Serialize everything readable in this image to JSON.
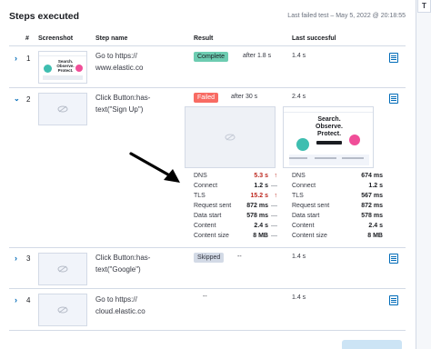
{
  "panel": {
    "title": "Steps executed",
    "last_failed": "Last failed test – May 5, 2022 @ 20:18:55",
    "edge_tab_label": "T"
  },
  "columns": [
    "#",
    "Screenshot",
    "Step name",
    "Result",
    "Last succesful"
  ],
  "steps": [
    {
      "num": "1",
      "name": "Go to https:// www.elastic.co",
      "status": "Complete",
      "status_tone": "success",
      "duration": "after 1.8 s",
      "last_successful": "1.4 s",
      "expanded": false
    },
    {
      "num": "2",
      "name": "Click Button:has-text(\"Sign Up\")",
      "status": "Failed",
      "status_tone": "danger",
      "duration": "after 30 s",
      "last_successful": "2.4 s",
      "expanded": true
    },
    {
      "num": "3",
      "name": "Click Button:has-text(\"Google\")",
      "status": "Skipped",
      "status_tone": "neutral",
      "duration": "--",
      "last_successful": "1.4 s",
      "expanded": false
    },
    {
      "num": "4",
      "name": "Go to https:// cloud.elastic.co",
      "status": "",
      "status_tone": "none",
      "duration": "--",
      "last_successful": "1.4 s",
      "expanded": false
    }
  ],
  "thumb_text": {
    "small": "Search. Observe. Protect.",
    "large": "Search. Observe. Protect."
  },
  "metrics_current": [
    {
      "label": "DNS",
      "value": "5.3 s",
      "trend": "↑",
      "bad": true
    },
    {
      "label": "Connect",
      "value": "1.2 s",
      "trend": "—",
      "bad": false
    },
    {
      "label": "TLS",
      "value": "15.2 s",
      "trend": "↑",
      "bad": true
    },
    {
      "label": "Request sent",
      "value": "872 ms",
      "trend": "—",
      "bad": false
    },
    {
      "label": "Data start",
      "value": "578 ms",
      "trend": "—",
      "bad": false
    },
    {
      "label": "Content",
      "value": "2.4 s",
      "trend": "—",
      "bad": false
    },
    {
      "label": "Content size",
      "value": "8 MB",
      "trend": "—",
      "bad": false
    }
  ],
  "metrics_last": [
    {
      "label": "DNS",
      "value": "674 ms"
    },
    {
      "label": "Connect",
      "value": "1.2 s"
    },
    {
      "label": "TLS",
      "value": "567 ms"
    },
    {
      "label": "Request sent",
      "value": "872 ms"
    },
    {
      "label": "Data start",
      "value": "578 ms"
    },
    {
      "label": "Content",
      "value": "2.4 s"
    },
    {
      "label": "Content size",
      "value": "8 MB"
    }
  ],
  "colors": {
    "accent": "#006bb8",
    "success_badge": "#6dccb1",
    "danger_badge": "#f86b63",
    "neutral_badge": "#d3dae6",
    "danger_text": "#bd271e"
  },
  "icons": {
    "expand": "chevron-right-icon",
    "collapse": "chevron-down-icon",
    "placeholder": "image-placeholder-icon",
    "details": "document-icon",
    "annotation": "arrow-annotation"
  }
}
